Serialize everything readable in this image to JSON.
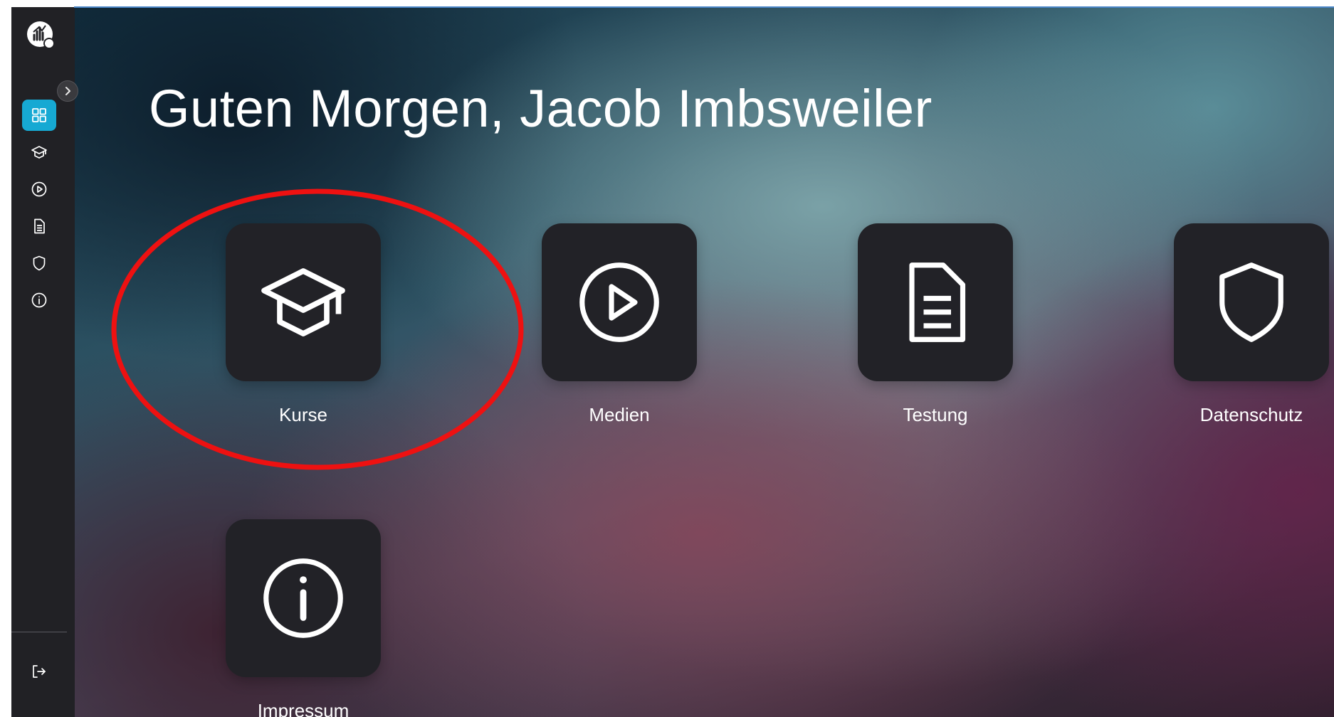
{
  "header": {
    "greeting": "Guten Morgen, Jacob Imbsweiler"
  },
  "sidebar": {
    "logo_icon": "app-logo-icon",
    "collapse_icon": "chevron-right-icon",
    "items": [
      {
        "icon": "dashboard-grid-icon",
        "active": true
      },
      {
        "icon": "graduation-cap-icon",
        "active": false
      },
      {
        "icon": "play-circle-icon",
        "active": false
      },
      {
        "icon": "document-icon",
        "active": false
      },
      {
        "icon": "shield-icon",
        "active": false
      },
      {
        "icon": "info-icon",
        "active": false
      }
    ],
    "logout_icon": "logout-icon",
    "active_color": "#16a9d3"
  },
  "tiles": [
    {
      "label": "Kurse",
      "icon": "graduation-cap-icon"
    },
    {
      "label": "Medien",
      "icon": "play-circle-icon"
    },
    {
      "label": "Testung",
      "icon": "document-icon"
    },
    {
      "label": "Datenschutz",
      "icon": "shield-icon"
    },
    {
      "label": "Impressum",
      "icon": "info-icon"
    }
  ],
  "annotation": {
    "shape": "ellipse",
    "color": "#ee1111",
    "target": "Kurse"
  }
}
